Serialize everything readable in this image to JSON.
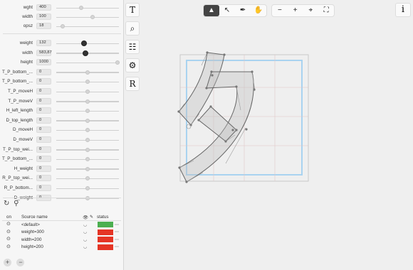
{
  "axes": [
    {
      "label": "wght",
      "value": "400",
      "fraction": 0.4
    },
    {
      "label": "width",
      "value": "100",
      "fraction": 0.58
    },
    {
      "label": "opsz",
      "value": "18",
      "fraction": 0.1
    }
  ],
  "params": [
    {
      "label": "weight",
      "value": "132",
      "fraction": 0.44,
      "dark": true
    },
    {
      "label": "width",
      "value": "583,87",
      "fraction": 0.47,
      "dark": true
    },
    {
      "label": "height",
      "value": "1000",
      "fraction": 0.98,
      "dark": false
    },
    {
      "label": "T_P_bottom_...",
      "value": "0",
      "fraction": 0.5,
      "dark": false
    },
    {
      "label": "T_P_bottom_...",
      "value": "0",
      "fraction": 0.5,
      "dark": false
    },
    {
      "label": "T_P_moveH",
      "value": "0",
      "fraction": 0.5,
      "dark": false
    },
    {
      "label": "T_P_moveV",
      "value": "0",
      "fraction": 0.5,
      "dark": false
    },
    {
      "label": "H_left_length",
      "value": "0",
      "fraction": 0.5,
      "dark": false
    },
    {
      "label": "D_top_length",
      "value": "0",
      "fraction": 0.5,
      "dark": false
    },
    {
      "label": "D_moveH",
      "value": "0",
      "fraction": 0.5,
      "dark": false
    },
    {
      "label": "D_moveV",
      "value": "0",
      "fraction": 0.5,
      "dark": false
    },
    {
      "label": "T_P_top_wei...",
      "value": "0",
      "fraction": 0.5,
      "dark": false
    },
    {
      "label": "T_P_bottom_...",
      "value": "0",
      "fraction": 0.5,
      "dark": false
    },
    {
      "label": "H_weight",
      "value": "0",
      "fraction": 0.5,
      "dark": false
    },
    {
      "label": "R_P_top_wei...",
      "value": "0",
      "fraction": 0.5,
      "dark": false
    },
    {
      "label": "R_P_bottom...",
      "value": "0",
      "fraction": 0.5,
      "dark": false
    },
    {
      "label": "D_weight",
      "value": "0",
      "fraction": 0.5,
      "dark": false
    }
  ],
  "sources_header": {
    "on": "on",
    "name": "Source name",
    "status": "status"
  },
  "sources": [
    {
      "name": "<default>",
      "color": "#4caf50"
    },
    {
      "name": "weight=300",
      "color": "#e53525"
    },
    {
      "name": "width=200",
      "color": "#e53525"
    },
    {
      "name": "height=200",
      "color": "#e53525"
    }
  ],
  "tool_strip": [
    "T",
    "⌕",
    "☷",
    "⚙",
    "R"
  ],
  "pointer_tools": [
    "▲",
    "↖",
    "✒",
    "✋"
  ],
  "zoom_tools": [
    "−",
    "+",
    "⌖",
    "⛶"
  ],
  "info_label": "i"
}
